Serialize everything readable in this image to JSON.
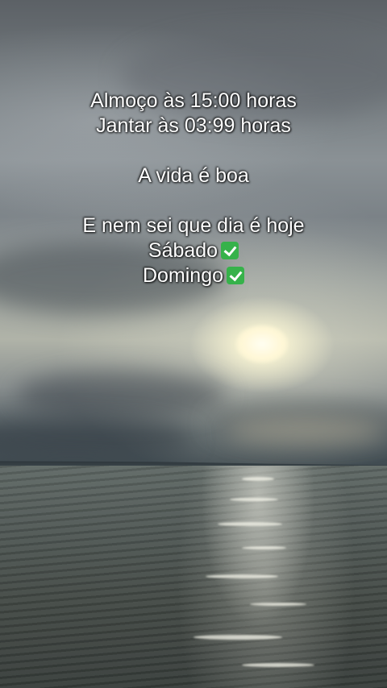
{
  "caption": {
    "line1": "Almoço às 15:00 horas",
    "line2": "Jantar às 03:99 horas",
    "line3": "A vida é boa",
    "line4": "E nem sei que dia é hoje",
    "line5": "Sábado",
    "line6": "Domingo"
  },
  "icons": {
    "check": "check-mark-button-icon"
  },
  "colors": {
    "caption_text": "#ffffff",
    "check_green": "#36b24a"
  }
}
